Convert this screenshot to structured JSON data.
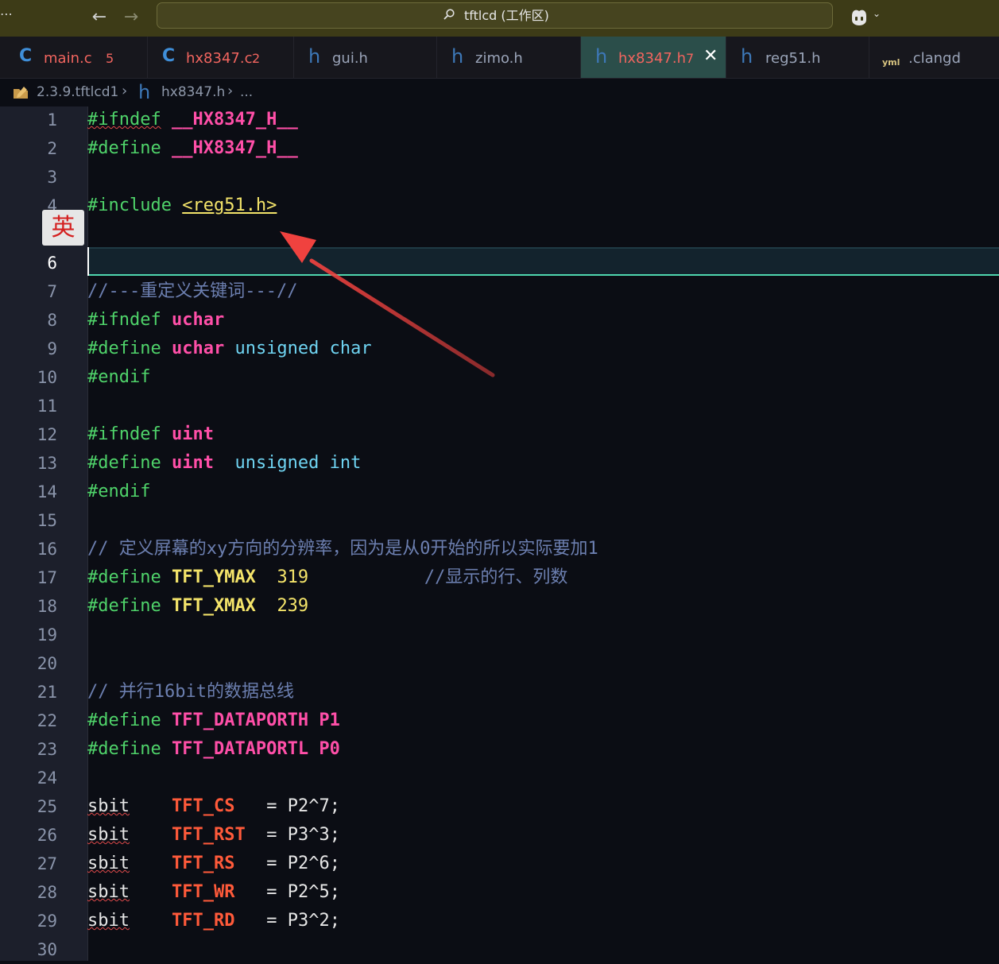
{
  "titlebar": {
    "menu_dots": "⋯",
    "back_icon": "←",
    "forward_icon": "→",
    "command_center_text": "tftlcd (工作区)",
    "copilot_chevron": "⌄"
  },
  "tabs": [
    {
      "icon": "C",
      "label": "main.c",
      "badge": "5",
      "status": "error"
    },
    {
      "icon": "C",
      "label": "hx8347.c",
      "badge": "2",
      "status": "error"
    },
    {
      "icon": "h",
      "label": "gui.h",
      "badge": "",
      "status": "normal"
    },
    {
      "icon": "h",
      "label": "zimo.h",
      "badge": "",
      "status": "normal"
    },
    {
      "icon": "h",
      "label": "hx8347.h",
      "badge": "7",
      "status": "error",
      "active": true,
      "close": "✕"
    },
    {
      "icon": "h",
      "label": "reg51.h",
      "badge": "",
      "status": "normal"
    },
    {
      "icon": "yml",
      "label": ".clangd",
      "badge": "",
      "status": "normal"
    }
  ],
  "breadcrumb": {
    "folder": "2.3.9.tftlcd1",
    "sep": "›",
    "file_icon": "h",
    "file": "hx8347.h",
    "rest": "..."
  },
  "ime_indicator": "英",
  "editor": {
    "current_line": "6",
    "line_numbers": [
      "1",
      "2",
      "3",
      "4",
      "",
      "6",
      "7",
      "8",
      "9",
      "10",
      "11",
      "12",
      "13",
      "14",
      "15",
      "16",
      "17",
      "18",
      "19",
      "20",
      "21",
      "22",
      "23",
      "24",
      "25",
      "26",
      "27",
      "28",
      "29",
      "30"
    ],
    "lines": {
      "l1_kw": "#ifndef",
      "l1_mac": "__HX8347_H__",
      "l2_kw": "#define",
      "l2_mac": "__HX8347_H__",
      "l4_kw": "#include",
      "l4_inc": "<reg51.h>",
      "l7_cmt": "//---重定义关键词---//",
      "l8_kw": "#ifndef",
      "l8_mac": "uchar",
      "l9_kw": "#define",
      "l9_mac": "uchar",
      "l9_typ": "unsigned char",
      "l10_kw": "#endif",
      "l12_kw": "#ifndef",
      "l12_mac": "uint",
      "l13_kw": "#define",
      "l13_mac": "uint",
      "l13_typ": "unsigned int",
      "l14_kw": "#endif",
      "l16_cmt": "// 定义屏幕的xy方向的分辨率，因为是从0开始的所以实际要加1",
      "l17_kw": "#define",
      "l17_mac": "TFT_YMAX",
      "l17_num": "319",
      "l17_cmt": "//显示的行、列数",
      "l18_kw": "#define",
      "l18_mac": "TFT_XMAX",
      "l18_num": "239",
      "l21_cmt": "// 并行16bit的数据总线",
      "l22_kw": "#define",
      "l22_mac": "TFT_DATAPORTH P1",
      "l23_kw": "#define",
      "l23_mac": "TFT_DATAPORTL P0",
      "sbit_rows": [
        {
          "kw": "sbit",
          "name": "TFT_CS",
          "expr": "= P2^7;"
        },
        {
          "kw": "sbit",
          "name": "TFT_RST",
          "expr": "= P3^3;"
        },
        {
          "kw": "sbit",
          "name": "TFT_RS",
          "expr": "= P2^6;"
        },
        {
          "kw": "sbit",
          "name": "TFT_WR",
          "expr": "= P2^5;"
        },
        {
          "kw": "sbit",
          "name": "TFT_RD",
          "expr": "= P3^2;"
        }
      ]
    }
  },
  "colors": {
    "titlebar_bg": "#3d3b17",
    "active_tab_bg": "#2b4e4a",
    "error": "#f2655f",
    "keyword": "#4fd36a",
    "macro": "#ff4fa8",
    "type": "#6fd4f2",
    "number": "#f4e46a",
    "comment": "#6c7fb0",
    "constant": "#ff5a3a",
    "annotation_arrow": "#f0423f"
  }
}
